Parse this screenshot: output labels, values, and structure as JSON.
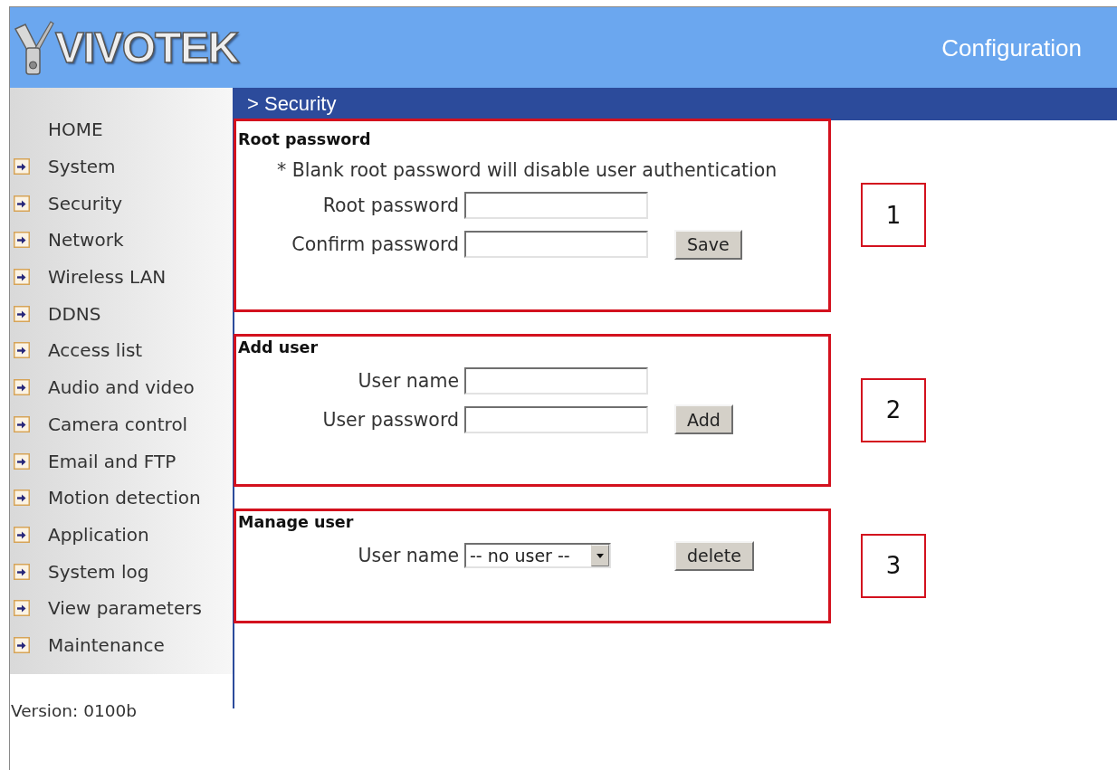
{
  "header": {
    "logo_text": "VIVOTEK",
    "title": "Configuration"
  },
  "sidebar": {
    "items": [
      {
        "label": "HOME",
        "kind": "page"
      },
      {
        "label": "System",
        "kind": "section"
      },
      {
        "label": "Security",
        "kind": "section"
      },
      {
        "label": "Network",
        "kind": "section"
      },
      {
        "label": "Wireless LAN",
        "kind": "section"
      },
      {
        "label": "DDNS",
        "kind": "section"
      },
      {
        "label": "Access list",
        "kind": "section"
      },
      {
        "label": "Audio and video",
        "kind": "section"
      },
      {
        "label": "Camera control",
        "kind": "section"
      },
      {
        "label": "Email and FTP",
        "kind": "section"
      },
      {
        "label": "Motion detection",
        "kind": "section"
      },
      {
        "label": "Application",
        "kind": "section"
      },
      {
        "label": "System log",
        "kind": "section"
      },
      {
        "label": "View parameters",
        "kind": "section"
      },
      {
        "label": "Maintenance",
        "kind": "section"
      }
    ],
    "version": "Version: 0100b"
  },
  "page_title": "> Security",
  "sections": [
    {
      "heading": "Root password",
      "note": "* Blank root password will disable user authentication",
      "fields": [
        {
          "kind": "text",
          "label": "Root password"
        },
        {
          "kind": "text",
          "label": "Confirm password"
        }
      ],
      "button": "Save",
      "callout": "1"
    },
    {
      "heading": "Add user",
      "fields": [
        {
          "kind": "text",
          "label": "User name"
        },
        {
          "kind": "text",
          "label": "User password"
        }
      ],
      "button": "Add",
      "callout": "2"
    },
    {
      "heading": "Manage user",
      "fields": [
        {
          "kind": "select",
          "label": "User name",
          "value": "-- no user --"
        }
      ],
      "button": "delete",
      "callout": "3"
    }
  ]
}
